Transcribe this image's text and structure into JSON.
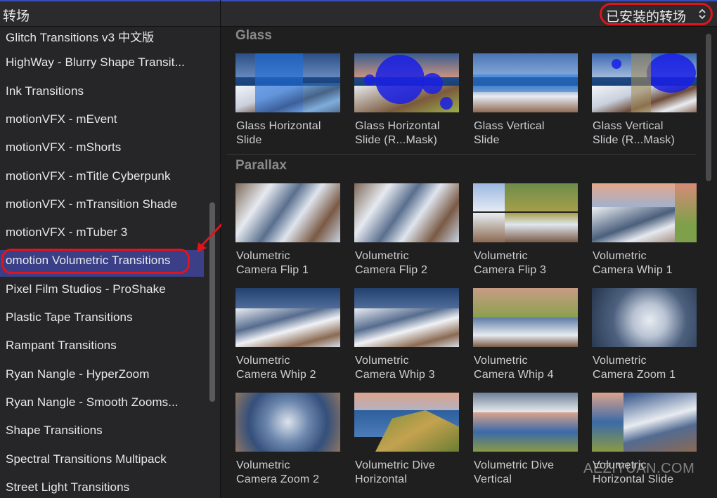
{
  "header": {
    "title": "转场",
    "filter_label": "已安装的转场"
  },
  "sidebar": {
    "items": [
      {
        "label": "Glitch Transitions v3 中文版"
      },
      {
        "label": "HighWay - Blurry Shape Transit..."
      },
      {
        "label": "Ink Transitions"
      },
      {
        "label": "motionVFX - mEvent"
      },
      {
        "label": "motionVFX - mShorts"
      },
      {
        "label": "motionVFX - mTitle Cyberpunk"
      },
      {
        "label": "motionVFX - mTransition Shade"
      },
      {
        "label": "motionVFX - mTuber 3"
      },
      {
        "label": "omotion Volumetric Transitions",
        "selected": true
      },
      {
        "label": "Pixel Film Studios - ProShake"
      },
      {
        "label": "Plastic Tape Transitions"
      },
      {
        "label": "Rampant Transitions"
      },
      {
        "label": "Ryan Nangle - HyperZoom"
      },
      {
        "label": "Ryan Nangle - Smooth Zooms..."
      },
      {
        "label": "Shape Transitions"
      },
      {
        "label": "Spectral Transitions Multipack"
      },
      {
        "label": "Street Light Transitions"
      }
    ]
  },
  "browser": {
    "sections": [
      {
        "title": "Glass",
        "items": [
          {
            "name": "Glass Horizontal\nSlide",
            "style": "glass-h"
          },
          {
            "name": "Glass Horizontal\nSlide (R...Mask)",
            "style": "glass-hm"
          },
          {
            "name": "Glass Vertical\nSlide",
            "style": "glass-v"
          },
          {
            "name": "Glass Vertical\nSlide (R...Mask)",
            "style": "glass-vm"
          }
        ]
      },
      {
        "title": "Parallax",
        "items": [
          {
            "name": "Volumetric\nCamera Flip 1",
            "style": "snow-blur"
          },
          {
            "name": "Volumetric\nCamera Flip 2",
            "style": "snow-blur"
          },
          {
            "name": "Volumetric\nCamera Flip 3",
            "style": "split-green"
          },
          {
            "name": "Volumetric\nCamera Whip 1",
            "style": "sunset-split"
          },
          {
            "name": "Volumetric\nCamera Whip 2",
            "style": "snow-mtn"
          },
          {
            "name": "Volumetric\nCamera Whip 3",
            "style": "snow-mtn"
          },
          {
            "name": "Volumetric\nCamera Whip 4",
            "style": "green-split"
          },
          {
            "name": "Volumetric\nCamera Zoom 1",
            "style": "zoom-snow"
          },
          {
            "name": "Volumetric\nCamera Zoom 2",
            "style": "zoom-blue"
          },
          {
            "name": "Volumetric Dive\nHorizontal",
            "style": "coast"
          },
          {
            "name": "Volumetric Dive\nVertical",
            "style": "coast-v"
          },
          {
            "name": "Volumetric\nHorizontal Slide",
            "style": "coast-snow"
          }
        ]
      }
    ]
  },
  "watermark": "AEZIYUAN.COM",
  "colors": {
    "selection": "#3a3f88",
    "annotation_red": "#e0141b"
  }
}
